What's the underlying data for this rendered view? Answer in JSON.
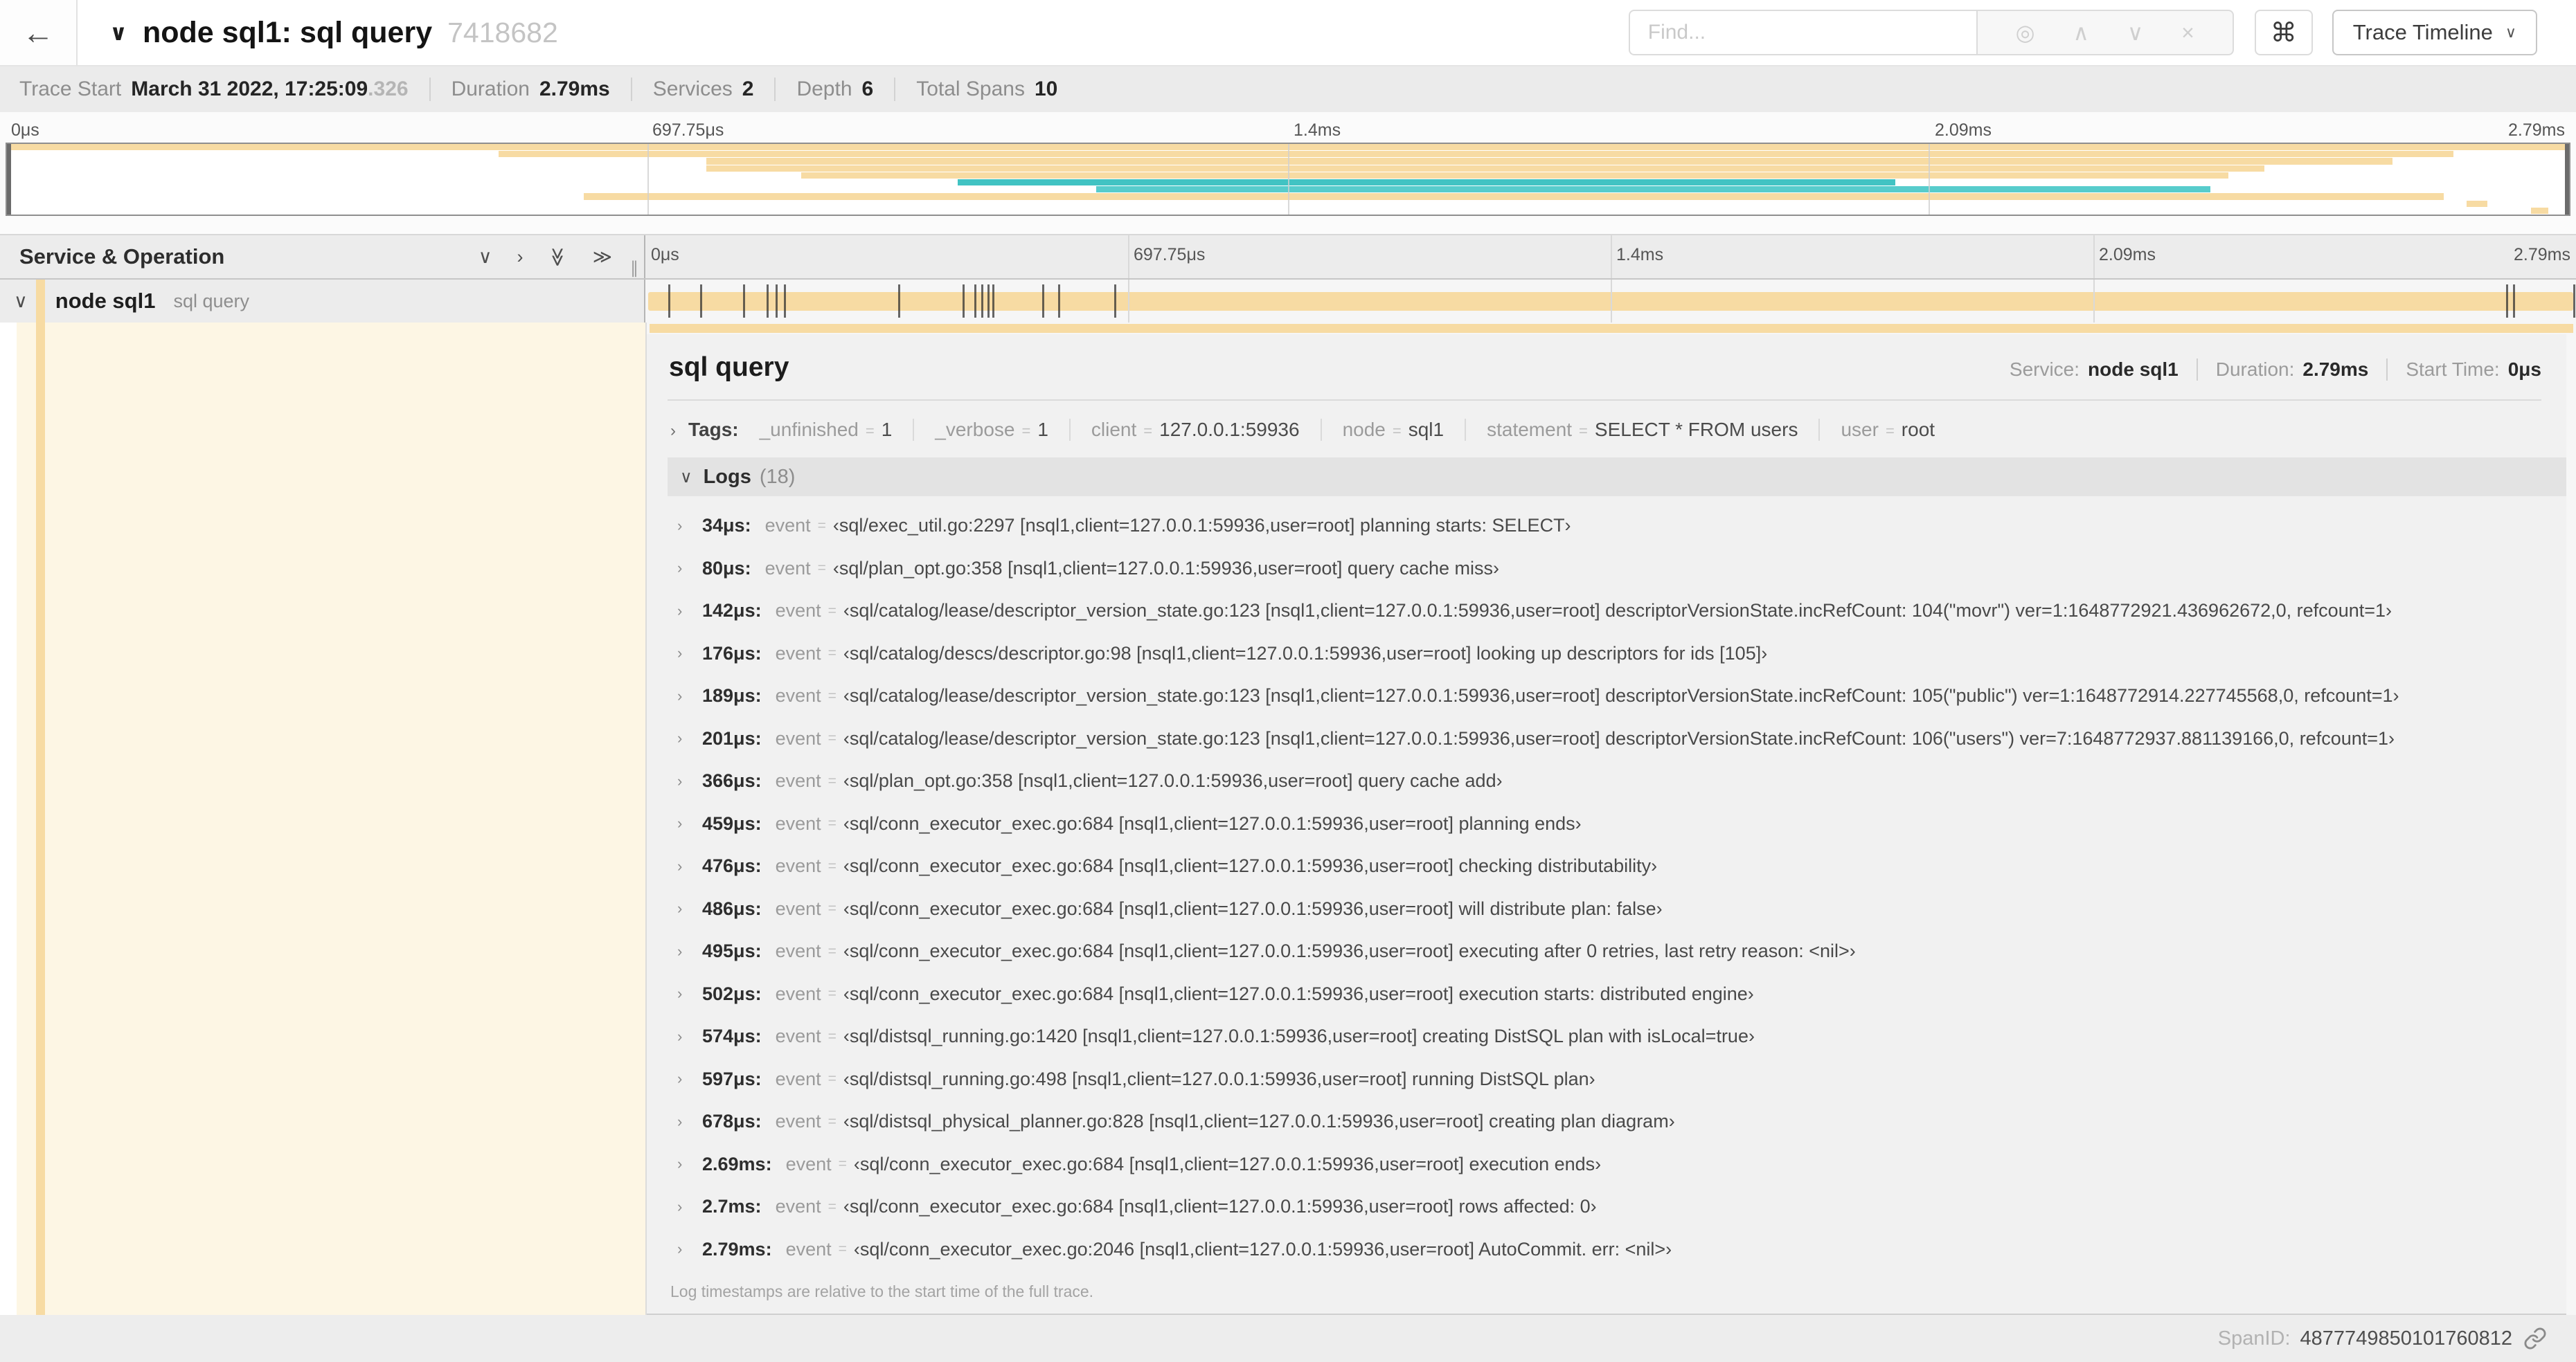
{
  "colors": {
    "tan": "#f7dba3",
    "teal": "#41c3c3",
    "teal_light": "#57cccc",
    "cream": "#fdf6e4"
  },
  "trace": {
    "total_us": 2790
  },
  "header": {
    "back_glyph": "←",
    "collapse_glyph": "∨",
    "title": "node sql1: sql query",
    "trace_id": "7418682",
    "find_placeholder": "Find...",
    "find_icons": [
      {
        "name": "match-target-icon",
        "glyph": "◎"
      },
      {
        "name": "prev-match-icon",
        "glyph": "∧"
      },
      {
        "name": "next-match-icon",
        "glyph": "∨"
      },
      {
        "name": "clear-search-icon",
        "glyph": "×"
      }
    ],
    "shortcuts_glyph": "⌘",
    "view_selector_label": "Trace Timeline",
    "view_selector_chevron": "∨"
  },
  "summary": {
    "items": [
      {
        "label": "Trace Start",
        "value": "March 31 2022, 17:25:09",
        "suffix": ".326"
      },
      {
        "label": "Duration",
        "value": "2.79ms"
      },
      {
        "label": "Services",
        "value": "2"
      },
      {
        "label": "Depth",
        "value": "6"
      },
      {
        "label": "Total Spans",
        "value": "10"
      }
    ]
  },
  "minimap": {
    "tick_labels": [
      "0μs",
      "697.75μs",
      "1.4ms",
      "2.09ms",
      "2.79ms"
    ],
    "spans": [
      {
        "start": 0.0,
        "end": 1.0,
        "color": "tan"
      },
      {
        "start": 0.192,
        "end": 0.955,
        "color": "tan"
      },
      {
        "start": 0.273,
        "end": 0.931,
        "color": "tan"
      },
      {
        "start": 0.273,
        "end": 0.881,
        "color": "tan"
      },
      {
        "start": 0.31,
        "end": 0.867,
        "color": "tan"
      },
      {
        "start": 0.371,
        "end": 0.737,
        "color": "teal"
      },
      {
        "start": 0.425,
        "end": 0.86,
        "color": "teal_light"
      },
      {
        "start": 0.225,
        "end": 0.951,
        "color": "tan"
      },
      {
        "start": 0.96,
        "end": 0.968,
        "color": "tan"
      },
      {
        "start": 0.985,
        "end": 0.992,
        "color": "tan"
      }
    ]
  },
  "timeline": {
    "left_header": "Service & Operation",
    "collapse_one_glyph": "∨",
    "expand_one_glyph": "›",
    "collapse_all_glyph": "≫",
    "expand_all_glyph": "≫",
    "resizer_glyph": "∥",
    "tick_labels": [
      "0μs",
      "697.75μs",
      "1.4ms",
      "2.09ms",
      "2.79ms"
    ]
  },
  "span_row": {
    "collapse_glyph": "∨",
    "service": "node sql1",
    "operation": "sql query"
  },
  "detail": {
    "title": "sql query",
    "meta": [
      {
        "label": "Service:",
        "value": "node sql1"
      },
      {
        "label": "Duration:",
        "value": "2.79ms"
      },
      {
        "label": "Start Time:",
        "value": "0μs"
      }
    ],
    "tags": {
      "expand_glyph": "›",
      "label": "Tags:",
      "eq": "=",
      "items": [
        {
          "key": "_unfinished",
          "value": "1"
        },
        {
          "key": "_verbose",
          "value": "1"
        },
        {
          "key": "client",
          "value": "127.0.0.1:59936"
        },
        {
          "key": "node",
          "value": "sql1"
        },
        {
          "key": "statement",
          "value": "SELECT * FROM users"
        },
        {
          "key": "user",
          "value": "root"
        }
      ]
    },
    "logs": {
      "collapse_glyph": "∨",
      "expand_glyph": "›",
      "label": "Logs",
      "count": "(18)",
      "key_label": "event",
      "eq": "=",
      "items": [
        {
          "time": "34μs:",
          "t_us": 34,
          "value": "‹sql/exec_util.go:2297 [nsql1,client=127.0.0.1:59936,user=root] planning starts: SELECT›"
        },
        {
          "time": "80μs:",
          "t_us": 80,
          "value": "‹sql/plan_opt.go:358 [nsql1,client=127.0.0.1:59936,user=root] query cache miss›"
        },
        {
          "time": "142μs:",
          "t_us": 142,
          "value": "‹sql/catalog/lease/descriptor_version_state.go:123 [nsql1,client=127.0.0.1:59936,user=root] descriptorVersionState.incRefCount: 104(\"movr\") ver=1:1648772921.436962672,0, refcount=1›"
        },
        {
          "time": "176μs:",
          "t_us": 176,
          "value": "‹sql/catalog/descs/descriptor.go:98 [nsql1,client=127.0.0.1:59936,user=root] looking up descriptors for ids [105]›"
        },
        {
          "time": "189μs:",
          "t_us": 189,
          "value": "‹sql/catalog/lease/descriptor_version_state.go:123 [nsql1,client=127.0.0.1:59936,user=root] descriptorVersionState.incRefCount: 105(\"public\") ver=1:1648772914.227745568,0, refcount=1›"
        },
        {
          "time": "201μs:",
          "t_us": 201,
          "value": "‹sql/catalog/lease/descriptor_version_state.go:123 [nsql1,client=127.0.0.1:59936,user=root] descriptorVersionState.incRefCount: 106(\"users\") ver=7:1648772937.881139166,0, refcount=1›"
        },
        {
          "time": "366μs:",
          "t_us": 366,
          "value": "‹sql/plan_opt.go:358 [nsql1,client=127.0.0.1:59936,user=root] query cache add›"
        },
        {
          "time": "459μs:",
          "t_us": 459,
          "value": "‹sql/conn_executor_exec.go:684 [nsql1,client=127.0.0.1:59936,user=root] planning ends›"
        },
        {
          "time": "476μs:",
          "t_us": 476,
          "value": "‹sql/conn_executor_exec.go:684 [nsql1,client=127.0.0.1:59936,user=root] checking distributability›"
        },
        {
          "time": "486μs:",
          "t_us": 486,
          "value": "‹sql/conn_executor_exec.go:684 [nsql1,client=127.0.0.1:59936,user=root] will distribute plan: false›"
        },
        {
          "time": "495μs:",
          "t_us": 495,
          "value": "‹sql/conn_executor_exec.go:684 [nsql1,client=127.0.0.1:59936,user=root] executing after 0 retries, last retry reason: <nil>›"
        },
        {
          "time": "502μs:",
          "t_us": 502,
          "value": "‹sql/conn_executor_exec.go:684 [nsql1,client=127.0.0.1:59936,user=root] execution starts: distributed engine›"
        },
        {
          "time": "574μs:",
          "t_us": 574,
          "value": "‹sql/distsql_running.go:1420 [nsql1,client=127.0.0.1:59936,user=root] creating DistSQL plan with isLocal=true›"
        },
        {
          "time": "597μs:",
          "t_us": 597,
          "value": "‹sql/distsql_running.go:498 [nsql1,client=127.0.0.1:59936,user=root] running DistSQL plan›"
        },
        {
          "time": "678μs:",
          "t_us": 678,
          "value": "‹sql/distsql_physical_planner.go:828 [nsql1,client=127.0.0.1:59936,user=root] creating plan diagram›"
        },
        {
          "time": "2.69ms:",
          "t_us": 2690,
          "value": "‹sql/conn_executor_exec.go:684 [nsql1,client=127.0.0.1:59936,user=root] execution ends›"
        },
        {
          "time": "2.7ms:",
          "t_us": 2700,
          "value": "‹sql/conn_executor_exec.go:684 [nsql1,client=127.0.0.1:59936,user=root] rows affected: 0›"
        },
        {
          "time": "2.79ms:",
          "t_us": 2790,
          "value": "‹sql/conn_executor_exec.go:2046 [nsql1,client=127.0.0.1:59936,user=root] AutoCommit. err: <nil>›"
        }
      ],
      "footnote": "Log timestamps are relative to the start time of the full trace."
    },
    "footer": {
      "span_id_label": "SpanID:",
      "span_id": "4877749850101760812"
    }
  }
}
